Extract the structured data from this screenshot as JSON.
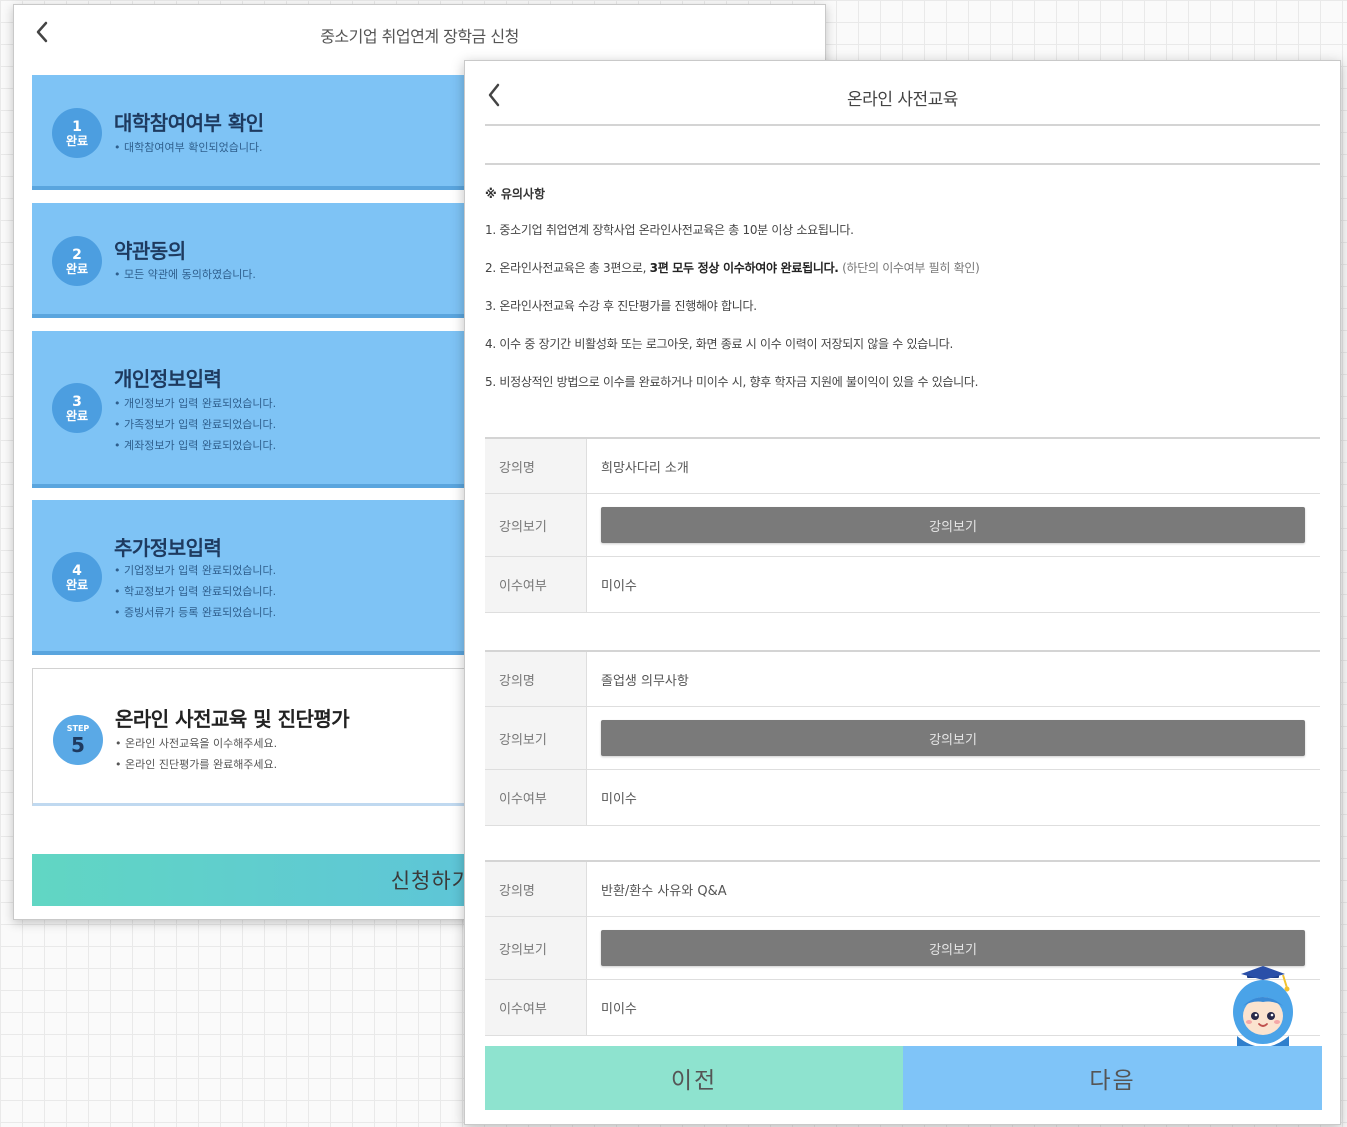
{
  "back_window": {
    "title": "중소기업 취업연계 장학금 신청",
    "steps": [
      {
        "num": "1",
        "status": "완료",
        "title": "대학참여여부 확인",
        "lines": [
          "대학참여여부 확인되었습니다."
        ]
      },
      {
        "num": "2",
        "status": "완료",
        "title": "약관동의",
        "lines": [
          "모든 약관에 동의하였습니다."
        ]
      },
      {
        "num": "3",
        "status": "완료",
        "title": "개인정보입력",
        "lines": [
          "개인정보가 입력 완료되었습니다.",
          "가족정보가 입력 완료되었습니다.",
          "계좌정보가 입력 완료되었습니다."
        ]
      },
      {
        "num": "4",
        "status": "완료",
        "title": "추가정보입력",
        "lines": [
          "기업정보가 입력 완료되었습니다.",
          "학교정보가 입력 완료되었습니다.",
          "증빙서류가 등록 완료되었습니다."
        ]
      }
    ],
    "step5": {
      "badge_label": "STEP",
      "num": "5",
      "title": "온라인 사전교육 및 진단평가",
      "lines": [
        "온라인 사전교육을 이수해주세요.",
        "온라인 진단평가를 완료해주세요."
      ]
    },
    "apply_label": "신청하기"
  },
  "front_window": {
    "title": "온라인 사전교육",
    "notice": {
      "heading": "※ 유의사항",
      "line1": "1. 중소기업 취업연계 장학사업 온라인사전교육은 총 10분 이상 소요됩니다.",
      "line2_a": "2. 온라인사전교육은 총 3편으로, ",
      "line2_b": "3편 모두 정상 이수하여야 완료됩니다.",
      "line2_c": " (하단의 이수여부 필히 확인)",
      "line3": "3. 온라인사전교육 수강 후 진단평가를 진행해야 합니다.",
      "line4": "4. 이수 중 장기간 비활성화 또는 로그아웃, 화면 종료 시 이수 이력이 저장되지 않을 수 있습니다.",
      "line5": "5. 비정상적인 방법으로 이수를 완료하거나 미이수 시, 향후 학자금 지원에 불이익이 있을 수 있습니다."
    },
    "labels": {
      "name": "강의명",
      "view": "강의보기",
      "status": "이수여부"
    },
    "lectures": [
      {
        "name": "희망사다리 소개",
        "button": "강의보기",
        "status": "미이수"
      },
      {
        "name": "졸업생 의무사항",
        "button": "강의보기",
        "status": "미이수"
      },
      {
        "name": "반환/환수 사유와 Q&A",
        "button": "강의보기",
        "status": "미이수"
      }
    ],
    "prev_label": "이전",
    "next_label": "다음"
  },
  "colors": {
    "step_blue": "#7ec3f5",
    "badge_blue": "#4c9ee0",
    "apply_gradient_start": "#61d6c3",
    "apply_gradient_end": "#5cb8e8",
    "prev_green": "#8ee3cf",
    "next_blue": "#7fc4f8",
    "view_button_gray": "#7a7a7a"
  },
  "icons": {
    "back": "chevron-left-icon",
    "mascot": "mascot-character-icon"
  }
}
